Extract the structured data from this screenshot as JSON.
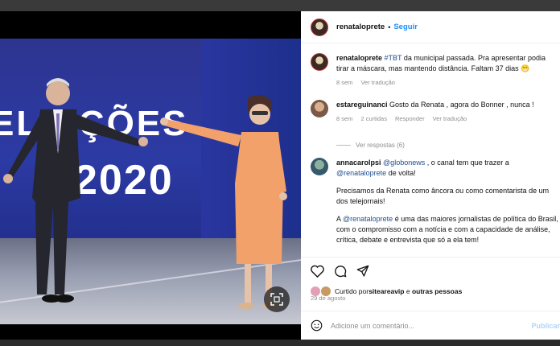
{
  "post": {
    "username": "renataloprete",
    "follow_label": "Seguir",
    "separator": "•"
  },
  "photo": {
    "wall_title": "ELEIÇÕES",
    "wall_year": "2020",
    "scan_icon": "visual-search-icon"
  },
  "caption": {
    "username": "renataloprete",
    "hashtag": "#TBT",
    "text": " da municipal passada. Pra apresentar podia tirar a máscara, mas mantendo distância. Faltam 37 dias 😁",
    "time": "8 sem",
    "translate": "Ver tradução"
  },
  "comments": [
    {
      "username": "estareguinanci",
      "text": " Gosto da Renata , agora do Bonner , nunca !",
      "time": "8 sem",
      "likes": "2 curtidas",
      "reply": "Responder",
      "translate": "Ver tradução",
      "view_replies": "Ver respostas (6)"
    },
    {
      "username": "annacarolpsi",
      "mention1": "@globonews",
      "text1": " , o canal tem que trazer a ",
      "mention2": "@renataloprete",
      "text2": " de volta!",
      "para2": "Precisamos da Renata como âncora ou como comentarista de um dos telejornais!",
      "para3_pre": "A ",
      "mention3": "@renataloprete",
      "para3_post": " é uma das maiores jornalistas de política do Brasil, com o compromisso com a notícia e com a capacidade de análise, crítica, debate e entrevista que só a ela tem!"
    }
  ],
  "actions": {
    "icons": [
      "heart-icon",
      "comment-icon",
      "share-icon"
    ],
    "liked_prefix": "Curtido por ",
    "liked_user": "siteareavip",
    "liked_join": " e ",
    "liked_others": "outras pessoas",
    "date": "29 de agosto"
  },
  "add_comment": {
    "placeholder": "Adicione um comentário...",
    "publish": "Publicar",
    "emoji_icon": "emoji-icon"
  },
  "colors": {
    "link": "#1f4e8c",
    "follow": "#1a8cff",
    "studio_blue": "#2c3aa4"
  }
}
